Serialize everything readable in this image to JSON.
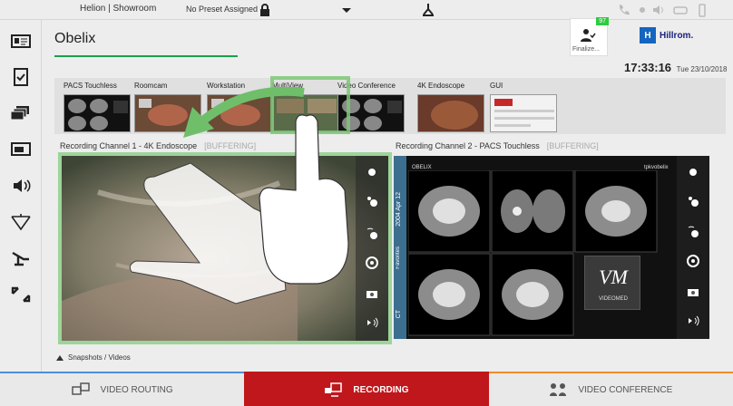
{
  "topbar": {
    "app_title": "Helion | Showroom",
    "preset": "No Preset Assigned",
    "icons": [
      "lock-icon",
      "dropdown-icon",
      "network-icon",
      "phone-icon",
      "record-dot-icon",
      "speaker-icon",
      "vr-icon",
      "battery-icon"
    ]
  },
  "sidebar": {
    "items": [
      {
        "icon": "patient-card-icon"
      },
      {
        "icon": "checklist-icon"
      },
      {
        "icon": "layers-icon"
      },
      {
        "icon": "screens-icon"
      },
      {
        "icon": "audio-icon"
      },
      {
        "icon": "ceiling-light-icon"
      },
      {
        "icon": "surgical-table-icon"
      },
      {
        "icon": "fullscreen-icon"
      }
    ]
  },
  "header": {
    "room_title": "Obelix",
    "finalize_label": "Finalize...",
    "finalize_badge": "97",
    "logo_mark": "H",
    "logo_text": "Hillrom.",
    "time": "17:33:16",
    "date": "Tue 23/10/2018"
  },
  "sources": [
    {
      "label": "PACS Touchless",
      "kind": "pacs"
    },
    {
      "label": "Roomcam",
      "kind": "surgery"
    },
    {
      "label": "Workstation",
      "kind": "surgery"
    },
    {
      "label": "MultiView",
      "kind": "multi"
    },
    {
      "label": "Video Conference",
      "kind": "pacs"
    },
    {
      "label": "4K Endoscope",
      "kind": "endo"
    },
    {
      "label": "GUI",
      "kind": "gui"
    }
  ],
  "channels": [
    {
      "title": "Recording Channel 1 - 4K Endoscope",
      "status": "[BUFFERING]"
    },
    {
      "title": "Recording Channel 2 - PACS Touchless",
      "status": "[BUFFERING]"
    }
  ],
  "pacs": {
    "patient": "OBELIX",
    "side_label": "Favorites",
    "side_date": "2004 Apr 12",
    "ct": "CT",
    "corner": "tpkvobelix",
    "brand_text": "VIDEOMED",
    "brand_mark": "VM"
  },
  "snapshots": {
    "label": "Snapshots / Videos"
  },
  "bottomnav": {
    "tabs": [
      {
        "label": "VIDEO ROUTING",
        "icon": "video-routing-icon"
      },
      {
        "label": "RECORDING",
        "icon": "recording-icon"
      },
      {
        "label": "VIDEO CONFERENCE",
        "icon": "video-conference-icon"
      }
    ]
  },
  "colors": {
    "accent_green": "#18a24a",
    "recording_red": "#c0171c",
    "routing_blue": "#4a90d9",
    "conference_orange": "#f28c28"
  }
}
